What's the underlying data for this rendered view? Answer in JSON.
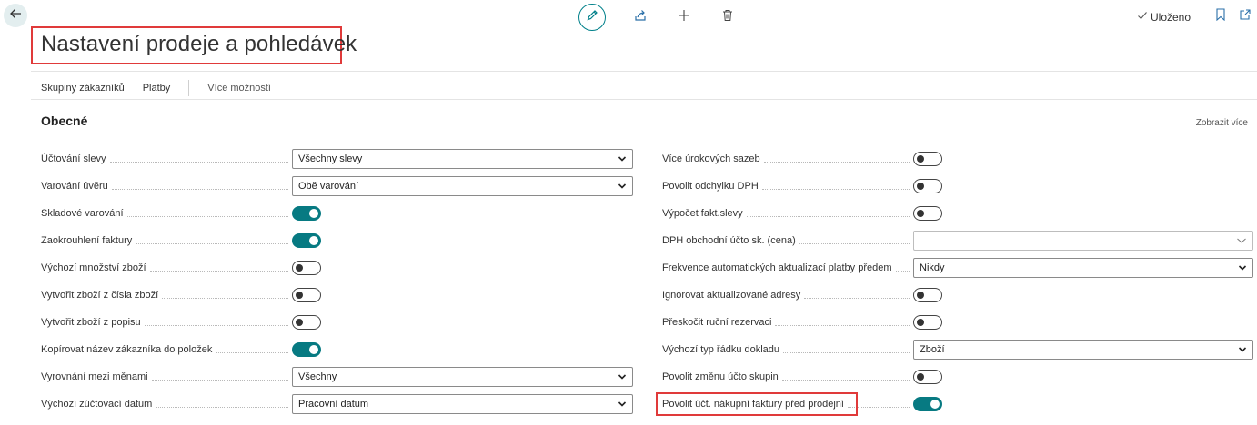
{
  "header": {
    "title": "Nastavení prodeje a pohledávek",
    "saved_label": "Uloženo"
  },
  "icons": {
    "back": "arrow-left-icon",
    "edit": "pencil-icon",
    "share": "share-icon",
    "add": "plus-icon",
    "delete": "trash-icon",
    "saved": "checkmark-icon",
    "bookmark": "bookmark-icon",
    "open_new": "open-in-new-window-icon"
  },
  "colors": {
    "accent": "#077a82",
    "highlight": "#e03a3a",
    "section_line": "#46607a"
  },
  "actions": {
    "customer_groups": "Skupiny zákazníků",
    "payments": "Platby",
    "more": "Více možností"
  },
  "section": {
    "title": "Obecné",
    "show_more": "Zobrazit více"
  },
  "left_fields": [
    {
      "label": "Účtování slevy",
      "type": "select",
      "value": "Všechny slevy"
    },
    {
      "label": "Varování úvěru",
      "type": "select",
      "value": "Obě varování"
    },
    {
      "label": "Skladové varování",
      "type": "toggle",
      "on": true
    },
    {
      "label": "Zaokrouhlení faktury",
      "type": "toggle",
      "on": true
    },
    {
      "label": "Výchozí množství zboží",
      "type": "toggle",
      "on": false
    },
    {
      "label": "Vytvořit zboží z čísla zboží",
      "type": "toggle",
      "on": false
    },
    {
      "label": "Vytvořit zboží z popisu",
      "type": "toggle",
      "on": false
    },
    {
      "label": "Kopírovat název zákazníka do položek",
      "type": "toggle",
      "on": true
    },
    {
      "label": "Vyrovnání mezi měnami",
      "type": "select",
      "value": "Všechny"
    },
    {
      "label": "Výchozí zúčtovací datum",
      "type": "select",
      "value": "Pracovní datum"
    }
  ],
  "right_fields": [
    {
      "label": "Více úrokových sazeb",
      "type": "toggle",
      "on": false
    },
    {
      "label": "Povolit odchylku DPH",
      "type": "toggle",
      "on": false
    },
    {
      "label": "Výpočet fakt.slevy",
      "type": "toggle",
      "on": false
    },
    {
      "label": "DPH obchodní účto sk. (cena)",
      "type": "select",
      "value": ""
    },
    {
      "label": "Frekvence automatických aktualizací platby předem",
      "type": "select",
      "value": "Nikdy"
    },
    {
      "label": "Ignorovat aktualizované adresy",
      "type": "toggle",
      "on": false
    },
    {
      "label": "Přeskočit ruční rezervaci",
      "type": "toggle",
      "on": false
    },
    {
      "label": "Výchozí typ řádku dokladu",
      "type": "select",
      "value": "Zboží"
    },
    {
      "label": "Povolit změnu účto skupin",
      "type": "toggle",
      "on": false
    },
    {
      "label": "Povolit účt. nákupní faktury před prodejní",
      "type": "toggle",
      "on": true
    }
  ]
}
